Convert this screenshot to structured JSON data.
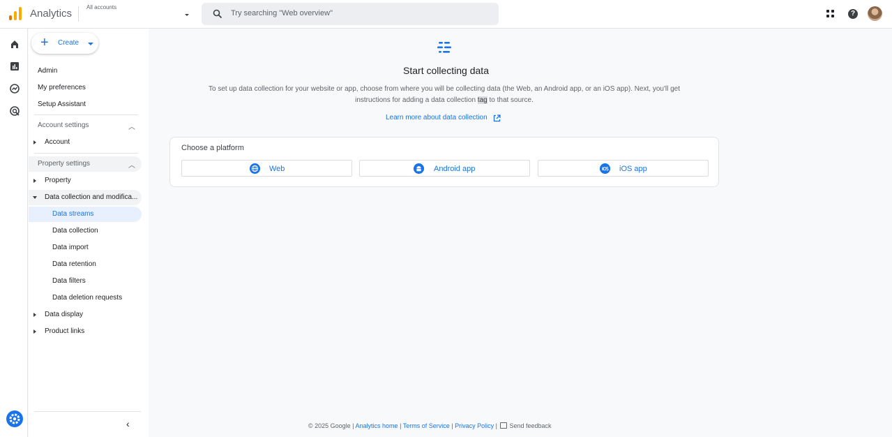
{
  "header": {
    "app_title": "Analytics",
    "accounts_label": "All accounts",
    "search_placeholder": "Try searching \"Web overview\""
  },
  "sidebar": {
    "create_label": "Create",
    "top_items": [
      "Admin",
      "My preferences",
      "Setup Assistant"
    ],
    "account_settings": {
      "label": "Account settings",
      "items": [
        "Account"
      ]
    },
    "property_settings": {
      "label": "Property settings",
      "items": [
        "Property",
        "Data collection and modifica..."
      ],
      "data_collection_sub": [
        "Data streams",
        "Data collection",
        "Data import",
        "Data retention",
        "Data filters",
        "Data deletion requests"
      ],
      "more_items": [
        "Data display",
        "Product links"
      ]
    },
    "active_item": "Data streams"
  },
  "main": {
    "title": "Start collecting data",
    "description_part1": "To set up data collection for your website or app, choose from where you will be collecting data (the Web, an Android app, or an iOS app). Next, you'll get instructions for adding a data collection ",
    "description_highlight": "tag",
    "description_part2": " to that source.",
    "learn_more": "Learn more about data collection",
    "platform_heading": "Choose a platform",
    "platforms": [
      "Web",
      "Android app",
      "iOS app"
    ]
  },
  "footer": {
    "copyright": "© 2025 Google | ",
    "analytics_home": "Analytics home",
    "terms": "Terms of Service",
    "privacy": "Privacy Policy",
    "feedback": "Send feedback"
  },
  "colors": {
    "accent": "#1a73e8",
    "logo_orange": "#f9ab00",
    "logo_dark": "#e37400"
  }
}
